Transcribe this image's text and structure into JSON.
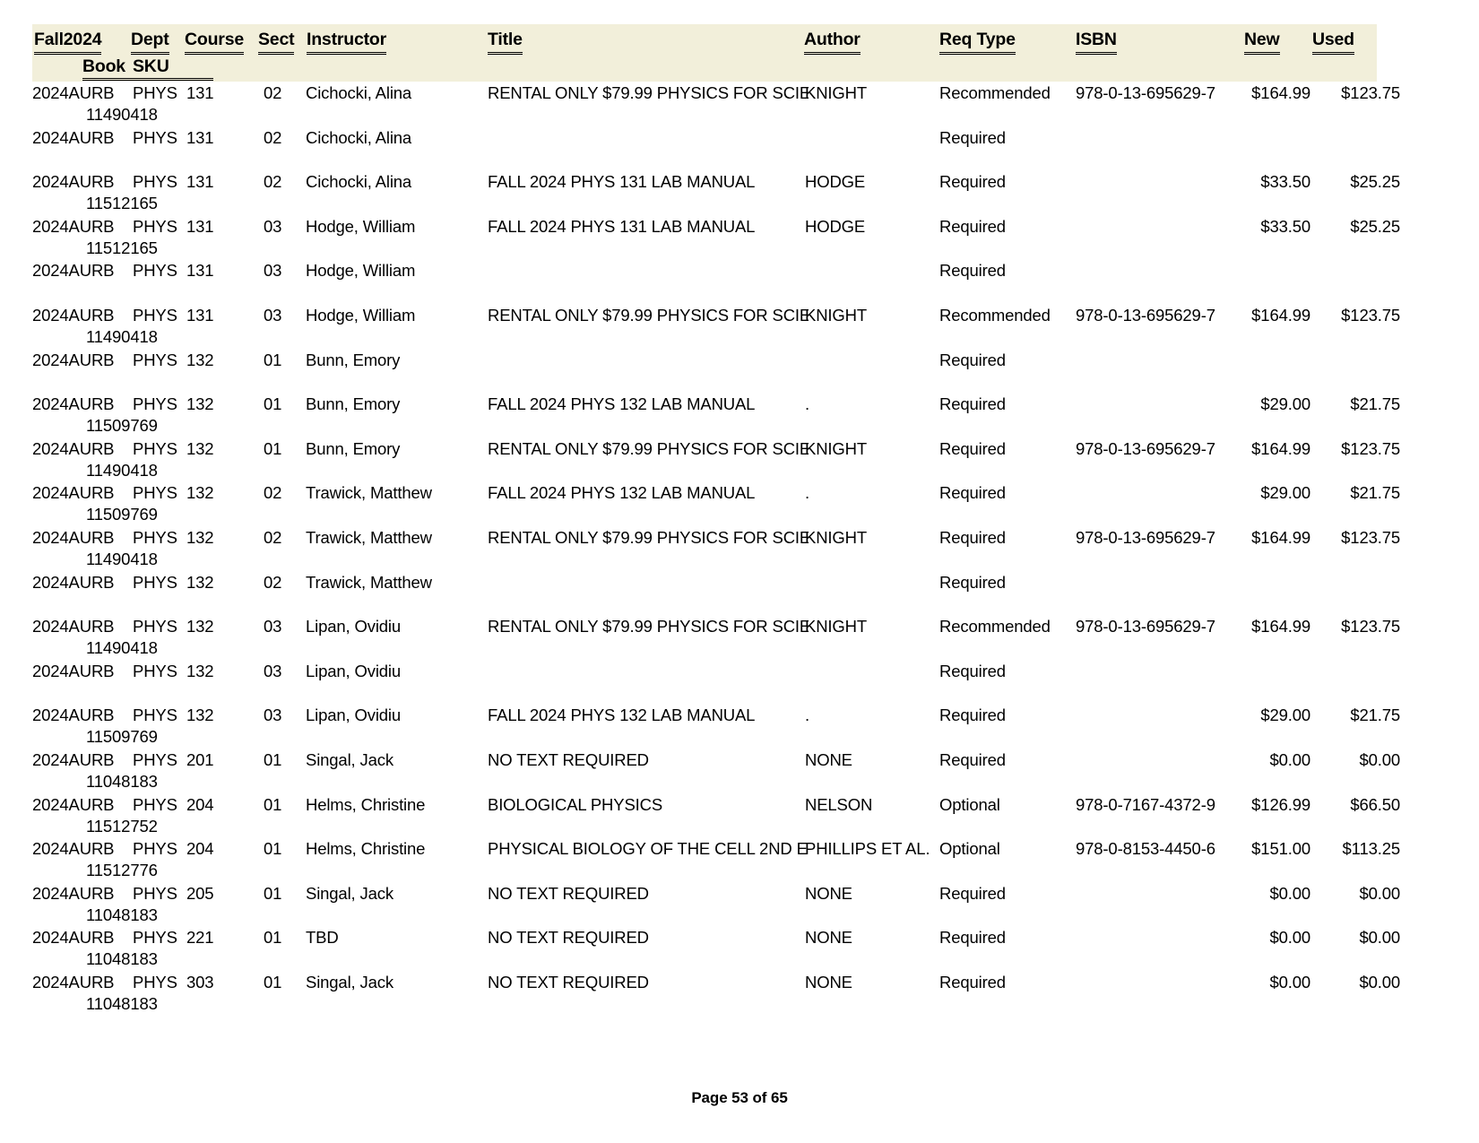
{
  "document": {
    "footer_text": "Page 53 of 65",
    "header_background": "#f2efda"
  },
  "table": {
    "headers_line1": {
      "term": "Fall2024",
      "dept": "Dept",
      "course": "Course",
      "sect": "Sect",
      "instructor": "Instructor",
      "title": "Title",
      "author": "Author",
      "req_type": "Req Type",
      "isbn": "ISBN",
      "new": "New",
      "used": "Used"
    },
    "headers_line2": {
      "book": "Book",
      "sku": "SKU"
    },
    "rows": [
      {
        "term": "2024AURB",
        "dept": "PHYS",
        "course": "131",
        "sect": "02",
        "instructor": "Cichocki, Alina",
        "title": "RENTAL ONLY $79.99 PHYSICS FOR SCIE",
        "author": "KNIGHT",
        "req_type": "Recommended",
        "isbn": "978-0-13-695629-7",
        "new": "$164.99",
        "used": "$123.75",
        "sku": "11490418"
      },
      {
        "term": "2024AURB",
        "dept": "PHYS",
        "course": "131",
        "sect": "02",
        "instructor": "Cichocki, Alina",
        "title": "",
        "author": "",
        "req_type": "Required",
        "isbn": "",
        "new": "",
        "used": "",
        "sku": ""
      },
      {
        "term": "2024AURB",
        "dept": "PHYS",
        "course": "131",
        "sect": "02",
        "instructor": "Cichocki, Alina",
        "title": "FALL 2024 PHYS 131 LAB MANUAL",
        "author": "HODGE",
        "req_type": "Required",
        "isbn": "",
        "new": "$33.50",
        "used": "$25.25",
        "sku": "11512165"
      },
      {
        "term": "2024AURB",
        "dept": "PHYS",
        "course": "131",
        "sect": "03",
        "instructor": "Hodge, William",
        "title": "FALL 2024 PHYS 131 LAB MANUAL",
        "author": "HODGE",
        "req_type": "Required",
        "isbn": "",
        "new": "$33.50",
        "used": "$25.25",
        "sku": "11512165"
      },
      {
        "term": "2024AURB",
        "dept": "PHYS",
        "course": "131",
        "sect": "03",
        "instructor": "Hodge, William",
        "title": "",
        "author": "",
        "req_type": "Required",
        "isbn": "",
        "new": "",
        "used": "",
        "sku": ""
      },
      {
        "term": "2024AURB",
        "dept": "PHYS",
        "course": "131",
        "sect": "03",
        "instructor": "Hodge, William",
        "title": "RENTAL ONLY $79.99 PHYSICS FOR SCIE",
        "author": "KNIGHT",
        "req_type": "Recommended",
        "isbn": "978-0-13-695629-7",
        "new": "$164.99",
        "used": "$123.75",
        "sku": "11490418"
      },
      {
        "term": "2024AURB",
        "dept": "PHYS",
        "course": "132",
        "sect": "01",
        "instructor": "Bunn, Emory",
        "title": "",
        "author": "",
        "req_type": "Required",
        "isbn": "",
        "new": "",
        "used": "",
        "sku": ""
      },
      {
        "term": "2024AURB",
        "dept": "PHYS",
        "course": "132",
        "sect": "01",
        "instructor": "Bunn, Emory",
        "title": "FALL 2024 PHYS 132 LAB MANUAL",
        "author": ".",
        "req_type": "Required",
        "isbn": "",
        "new": "$29.00",
        "used": "$21.75",
        "sku": "11509769"
      },
      {
        "term": "2024AURB",
        "dept": "PHYS",
        "course": "132",
        "sect": "01",
        "instructor": "Bunn, Emory",
        "title": "RENTAL ONLY $79.99 PHYSICS FOR SCIE",
        "author": "KNIGHT",
        "req_type": "Required",
        "isbn": "978-0-13-695629-7",
        "new": "$164.99",
        "used": "$123.75",
        "sku": "11490418"
      },
      {
        "term": "2024AURB",
        "dept": "PHYS",
        "course": "132",
        "sect": "02",
        "instructor": "Trawick, Matthew",
        "title": "FALL 2024 PHYS 132 LAB MANUAL",
        "author": ".",
        "req_type": "Required",
        "isbn": "",
        "new": "$29.00",
        "used": "$21.75",
        "sku": "11509769"
      },
      {
        "term": "2024AURB",
        "dept": "PHYS",
        "course": "132",
        "sect": "02",
        "instructor": "Trawick, Matthew",
        "title": "RENTAL ONLY $79.99 PHYSICS FOR SCIE",
        "author": "KNIGHT",
        "req_type": "Required",
        "isbn": "978-0-13-695629-7",
        "new": "$164.99",
        "used": "$123.75",
        "sku": "11490418"
      },
      {
        "term": "2024AURB",
        "dept": "PHYS",
        "course": "132",
        "sect": "02",
        "instructor": "Trawick, Matthew",
        "title": "",
        "author": "",
        "req_type": "Required",
        "isbn": "",
        "new": "",
        "used": "",
        "sku": ""
      },
      {
        "term": "2024AURB",
        "dept": "PHYS",
        "course": "132",
        "sect": "03",
        "instructor": "Lipan, Ovidiu",
        "title": "RENTAL ONLY $79.99 PHYSICS FOR SCIE",
        "author": "KNIGHT",
        "req_type": "Recommended",
        "isbn": "978-0-13-695629-7",
        "new": "$164.99",
        "used": "$123.75",
        "sku": "11490418"
      },
      {
        "term": "2024AURB",
        "dept": "PHYS",
        "course": "132",
        "sect": "03",
        "instructor": "Lipan, Ovidiu",
        "title": "",
        "author": "",
        "req_type": "Required",
        "isbn": "",
        "new": "",
        "used": "",
        "sku": ""
      },
      {
        "term": "2024AURB",
        "dept": "PHYS",
        "course": "132",
        "sect": "03",
        "instructor": "Lipan, Ovidiu",
        "title": "FALL 2024 PHYS 132 LAB MANUAL",
        "author": ".",
        "req_type": "Required",
        "isbn": "",
        "new": "$29.00",
        "used": "$21.75",
        "sku": "11509769"
      },
      {
        "term": "2024AURB",
        "dept": "PHYS",
        "course": "201",
        "sect": "01",
        "instructor": "Singal, Jack",
        "title": "NO TEXT REQUIRED",
        "author": "NONE",
        "req_type": "Required",
        "isbn": "",
        "new": "$0.00",
        "used": "$0.00",
        "sku": "11048183"
      },
      {
        "term": "2024AURB",
        "dept": "PHYS",
        "course": "204",
        "sect": "01",
        "instructor": "Helms, Christine",
        "title": "BIOLOGICAL PHYSICS",
        "author": "NELSON",
        "req_type": "Optional",
        "isbn": "978-0-7167-4372-9",
        "new": "$126.99",
        "used": "$66.50",
        "sku": "11512752"
      },
      {
        "term": "2024AURB",
        "dept": "PHYS",
        "course": "204",
        "sect": "01",
        "instructor": "Helms, Christine",
        "title": "PHYSICAL BIOLOGY OF THE CELL 2ND E",
        "author": "PHILLIPS ET AL.",
        "req_type": "Optional",
        "isbn": "978-0-8153-4450-6",
        "new": "$151.00",
        "used": "$113.25",
        "sku": "11512776"
      },
      {
        "term": "2024AURB",
        "dept": "PHYS",
        "course": "205",
        "sect": "01",
        "instructor": "Singal, Jack",
        "title": "NO TEXT REQUIRED",
        "author": "NONE",
        "req_type": "Required",
        "isbn": "",
        "new": "$0.00",
        "used": "$0.00",
        "sku": "11048183"
      },
      {
        "term": "2024AURB",
        "dept": "PHYS",
        "course": "221",
        "sect": "01",
        "instructor": "TBD",
        "title": "NO TEXT REQUIRED",
        "author": "NONE",
        "req_type": "Required",
        "isbn": "",
        "new": "$0.00",
        "used": "$0.00",
        "sku": "11048183"
      },
      {
        "term": "2024AURB",
        "dept": "PHYS",
        "course": "303",
        "sect": "01",
        "instructor": "Singal, Jack",
        "title": "NO TEXT REQUIRED",
        "author": "NONE",
        "req_type": "Required",
        "isbn": "",
        "new": "$0.00",
        "used": "$0.00",
        "sku": "11048183"
      }
    ]
  }
}
